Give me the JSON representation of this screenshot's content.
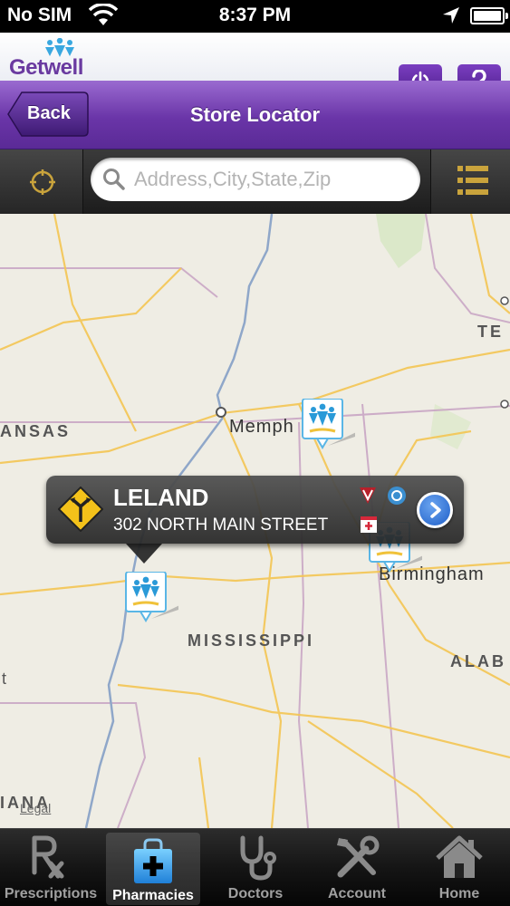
{
  "status_bar": {
    "carrier": "No SIM",
    "time": "8:37 PM"
  },
  "brand": {
    "logo_text": "Getwell",
    "accent_color": "#6a35a8"
  },
  "nav": {
    "back_label": "Back",
    "title": "Store Locator"
  },
  "search": {
    "placeholder": "Address,City,State,Zip",
    "value": ""
  },
  "map": {
    "labels": {
      "state_west": "ANSAS",
      "state_east": "TE",
      "state_center": "MISSISSIPPI",
      "state_alab": "ALAB",
      "state_southwest": "IANA",
      "fragment_left": "t"
    },
    "cities": {
      "memphis": "Memph",
      "birmingham": "Birmingham"
    },
    "legal": "Legal"
  },
  "callout": {
    "store_name": "LELAND",
    "address": "302 NORTH MAIN STREET",
    "icons": [
      "direction-sign-icon",
      "vaccine-icon",
      "medication-icon",
      "clinic-icon",
      "chevron-right-icon"
    ]
  },
  "tabs": [
    {
      "label": "Prescriptions",
      "icon": "rx-icon",
      "active": false
    },
    {
      "label": "Pharmacies",
      "icon": "pharmacy-bag-icon",
      "active": true
    },
    {
      "label": "Doctors",
      "icon": "stethoscope-icon",
      "active": false
    },
    {
      "label": "Account",
      "icon": "tools-icon",
      "active": false
    },
    {
      "label": "Home",
      "icon": "house-icon",
      "active": false
    }
  ]
}
